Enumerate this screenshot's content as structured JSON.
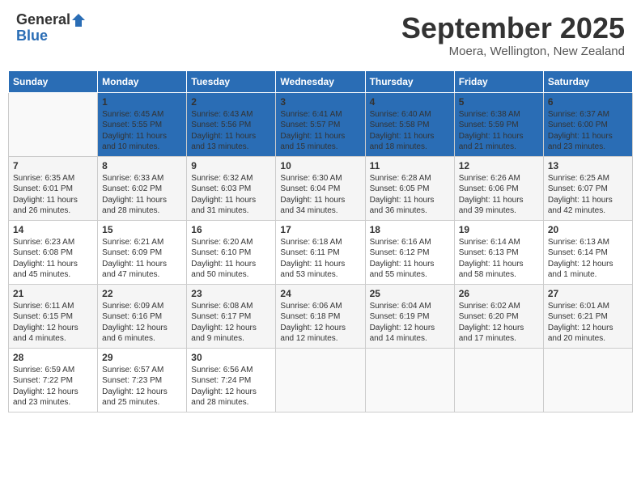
{
  "header": {
    "logo_general": "General",
    "logo_blue": "Blue",
    "month_title": "September 2025",
    "location": "Moera, Wellington, New Zealand"
  },
  "days_of_week": [
    "Sunday",
    "Monday",
    "Tuesday",
    "Wednesday",
    "Thursday",
    "Friday",
    "Saturday"
  ],
  "weeks": [
    [
      {
        "day": "",
        "sunrise": "",
        "sunset": "",
        "daylight": ""
      },
      {
        "day": "1",
        "sunrise": "Sunrise: 6:45 AM",
        "sunset": "Sunset: 5:55 PM",
        "daylight": "Daylight: 11 hours and 10 minutes."
      },
      {
        "day": "2",
        "sunrise": "Sunrise: 6:43 AM",
        "sunset": "Sunset: 5:56 PM",
        "daylight": "Daylight: 11 hours and 13 minutes."
      },
      {
        "day": "3",
        "sunrise": "Sunrise: 6:41 AM",
        "sunset": "Sunset: 5:57 PM",
        "daylight": "Daylight: 11 hours and 15 minutes."
      },
      {
        "day": "4",
        "sunrise": "Sunrise: 6:40 AM",
        "sunset": "Sunset: 5:58 PM",
        "daylight": "Daylight: 11 hours and 18 minutes."
      },
      {
        "day": "5",
        "sunrise": "Sunrise: 6:38 AM",
        "sunset": "Sunset: 5:59 PM",
        "daylight": "Daylight: 11 hours and 21 minutes."
      },
      {
        "day": "6",
        "sunrise": "Sunrise: 6:37 AM",
        "sunset": "Sunset: 6:00 PM",
        "daylight": "Daylight: 11 hours and 23 minutes."
      }
    ],
    [
      {
        "day": "7",
        "sunrise": "Sunrise: 6:35 AM",
        "sunset": "Sunset: 6:01 PM",
        "daylight": "Daylight: 11 hours and 26 minutes."
      },
      {
        "day": "8",
        "sunrise": "Sunrise: 6:33 AM",
        "sunset": "Sunset: 6:02 PM",
        "daylight": "Daylight: 11 hours and 28 minutes."
      },
      {
        "day": "9",
        "sunrise": "Sunrise: 6:32 AM",
        "sunset": "Sunset: 6:03 PM",
        "daylight": "Daylight: 11 hours and 31 minutes."
      },
      {
        "day": "10",
        "sunrise": "Sunrise: 6:30 AM",
        "sunset": "Sunset: 6:04 PM",
        "daylight": "Daylight: 11 hours and 34 minutes."
      },
      {
        "day": "11",
        "sunrise": "Sunrise: 6:28 AM",
        "sunset": "Sunset: 6:05 PM",
        "daylight": "Daylight: 11 hours and 36 minutes."
      },
      {
        "day": "12",
        "sunrise": "Sunrise: 6:26 AM",
        "sunset": "Sunset: 6:06 PM",
        "daylight": "Daylight: 11 hours and 39 minutes."
      },
      {
        "day": "13",
        "sunrise": "Sunrise: 6:25 AM",
        "sunset": "Sunset: 6:07 PM",
        "daylight": "Daylight: 11 hours and 42 minutes."
      }
    ],
    [
      {
        "day": "14",
        "sunrise": "Sunrise: 6:23 AM",
        "sunset": "Sunset: 6:08 PM",
        "daylight": "Daylight: 11 hours and 45 minutes."
      },
      {
        "day": "15",
        "sunrise": "Sunrise: 6:21 AM",
        "sunset": "Sunset: 6:09 PM",
        "daylight": "Daylight: 11 hours and 47 minutes."
      },
      {
        "day": "16",
        "sunrise": "Sunrise: 6:20 AM",
        "sunset": "Sunset: 6:10 PM",
        "daylight": "Daylight: 11 hours and 50 minutes."
      },
      {
        "day": "17",
        "sunrise": "Sunrise: 6:18 AM",
        "sunset": "Sunset: 6:11 PM",
        "daylight": "Daylight: 11 hours and 53 minutes."
      },
      {
        "day": "18",
        "sunrise": "Sunrise: 6:16 AM",
        "sunset": "Sunset: 6:12 PM",
        "daylight": "Daylight: 11 hours and 55 minutes."
      },
      {
        "day": "19",
        "sunrise": "Sunrise: 6:14 AM",
        "sunset": "Sunset: 6:13 PM",
        "daylight": "Daylight: 11 hours and 58 minutes."
      },
      {
        "day": "20",
        "sunrise": "Sunrise: 6:13 AM",
        "sunset": "Sunset: 6:14 PM",
        "daylight": "Daylight: 12 hours and 1 minute."
      }
    ],
    [
      {
        "day": "21",
        "sunrise": "Sunrise: 6:11 AM",
        "sunset": "Sunset: 6:15 PM",
        "daylight": "Daylight: 12 hours and 4 minutes."
      },
      {
        "day": "22",
        "sunrise": "Sunrise: 6:09 AM",
        "sunset": "Sunset: 6:16 PM",
        "daylight": "Daylight: 12 hours and 6 minutes."
      },
      {
        "day": "23",
        "sunrise": "Sunrise: 6:08 AM",
        "sunset": "Sunset: 6:17 PM",
        "daylight": "Daylight: 12 hours and 9 minutes."
      },
      {
        "day": "24",
        "sunrise": "Sunrise: 6:06 AM",
        "sunset": "Sunset: 6:18 PM",
        "daylight": "Daylight: 12 hours and 12 minutes."
      },
      {
        "day": "25",
        "sunrise": "Sunrise: 6:04 AM",
        "sunset": "Sunset: 6:19 PM",
        "daylight": "Daylight: 12 hours and 14 minutes."
      },
      {
        "day": "26",
        "sunrise": "Sunrise: 6:02 AM",
        "sunset": "Sunset: 6:20 PM",
        "daylight": "Daylight: 12 hours and 17 minutes."
      },
      {
        "day": "27",
        "sunrise": "Sunrise: 6:01 AM",
        "sunset": "Sunset: 6:21 PM",
        "daylight": "Daylight: 12 hours and 20 minutes."
      }
    ],
    [
      {
        "day": "28",
        "sunrise": "Sunrise: 6:59 AM",
        "sunset": "Sunset: 7:22 PM",
        "daylight": "Daylight: 12 hours and 23 minutes."
      },
      {
        "day": "29",
        "sunrise": "Sunrise: 6:57 AM",
        "sunset": "Sunset: 7:23 PM",
        "daylight": "Daylight: 12 hours and 25 minutes."
      },
      {
        "day": "30",
        "sunrise": "Sunrise: 6:56 AM",
        "sunset": "Sunset: 7:24 PM",
        "daylight": "Daylight: 12 hours and 28 minutes."
      },
      {
        "day": "",
        "sunrise": "",
        "sunset": "",
        "daylight": ""
      },
      {
        "day": "",
        "sunrise": "",
        "sunset": "",
        "daylight": ""
      },
      {
        "day": "",
        "sunrise": "",
        "sunset": "",
        "daylight": ""
      },
      {
        "day": "",
        "sunrise": "",
        "sunset": "",
        "daylight": ""
      }
    ]
  ]
}
